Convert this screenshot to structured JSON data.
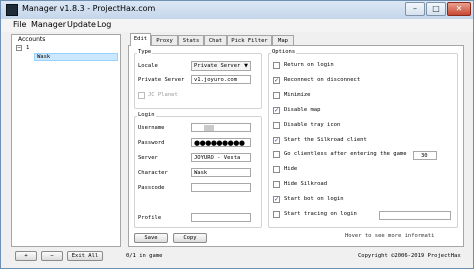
{
  "window": {
    "title": "Manager v1.8.3 - ProjectHax.com",
    "controls": {
      "minimize": "–",
      "maximize": "□",
      "close": "✕"
    }
  },
  "menu": [
    "File",
    "Manager",
    "Update",
    "Log"
  ],
  "accounts": {
    "header": "Accounts",
    "tree_root": "1",
    "tree_expand": "−",
    "selected_item": "Wask"
  },
  "tabs": [
    "Edit",
    "Proxy",
    "Stats",
    "Chat",
    "Pick Filter",
    "Map"
  ],
  "type_group": {
    "label": "Type",
    "locale_label": "Locale",
    "locale_value": "Private Server",
    "private_server_label": "Private Server",
    "private_server_value": "v1.joyuro.com",
    "jc_planet_label": "JC Planet",
    "jc_planet_checked": false
  },
  "login_group": {
    "label": "Login",
    "username_label": "Username",
    "username_value": "",
    "password_label": "Password",
    "password_value": "●●●●●●●●●",
    "server_label": "Server",
    "server_value": "JOYURO - Vesta",
    "character_label": "Character",
    "character_value": "Wask",
    "passcode_label": "Passcode",
    "passcode_value": "",
    "profile_label": "Profile",
    "profile_value": ""
  },
  "options_group": {
    "label": "Options",
    "items": [
      {
        "label": "Return on login",
        "checked": false
      },
      {
        "label": "Reconnect on disconnect",
        "checked": true
      },
      {
        "label": "Minimize",
        "checked": false
      },
      {
        "label": "Disable map",
        "checked": true
      },
      {
        "label": "Disable tray icon",
        "checked": false
      },
      {
        "label": "Start the Silkroad client",
        "checked": true
      },
      {
        "label": "Go clientless after entering the game",
        "checked": false
      },
      {
        "label": "Hide",
        "checked": false
      },
      {
        "label": "Hide Silkroad",
        "checked": false
      },
      {
        "label": "Start bot on login",
        "checked": true
      },
      {
        "label": "Start tracing on login",
        "checked": false
      }
    ],
    "clientless_value": "30",
    "hover_note": "Hover to see more informati"
  },
  "buttons": {
    "save": "Save",
    "copy": "Copy",
    "up": "+",
    "down": "−",
    "exit_all": "Exit All"
  },
  "status": {
    "in_game": "0/1 in game",
    "copyright": "Copyright ©2006-2019 ProjectHax"
  }
}
